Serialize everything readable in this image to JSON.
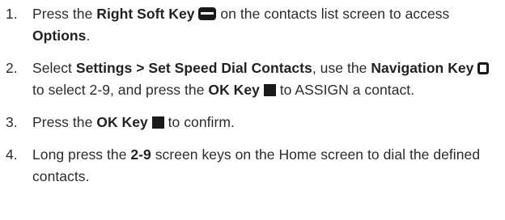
{
  "steps": [
    {
      "number": "1.",
      "t1": "Press the ",
      "b1": "Right Soft Key",
      "t2": " on the contacts list screen to access ",
      "b2": "Options",
      "t3": "."
    },
    {
      "number": "2.",
      "t1": "Select ",
      "b1": "Settings > Set Speed Dial Contacts",
      "t2": ", use the ",
      "b2": "Navigation Key",
      "t3": " to select 2-9, and press the ",
      "b3": "OK Key",
      "t4": " to ASSIGN a contact."
    },
    {
      "number": "3.",
      "t1": "Press the ",
      "b1": "OK Key",
      "t2": " to confirm."
    },
    {
      "number": "4.",
      "t1": "Long press the ",
      "b1": "2-9",
      "t2": " screen keys on the Home screen to dial the defined contacts."
    }
  ],
  "icons": {
    "right_soft_key": "right-soft-key-icon",
    "navigation_key": "navigation-key-icon",
    "ok_key": "ok-key-icon"
  }
}
